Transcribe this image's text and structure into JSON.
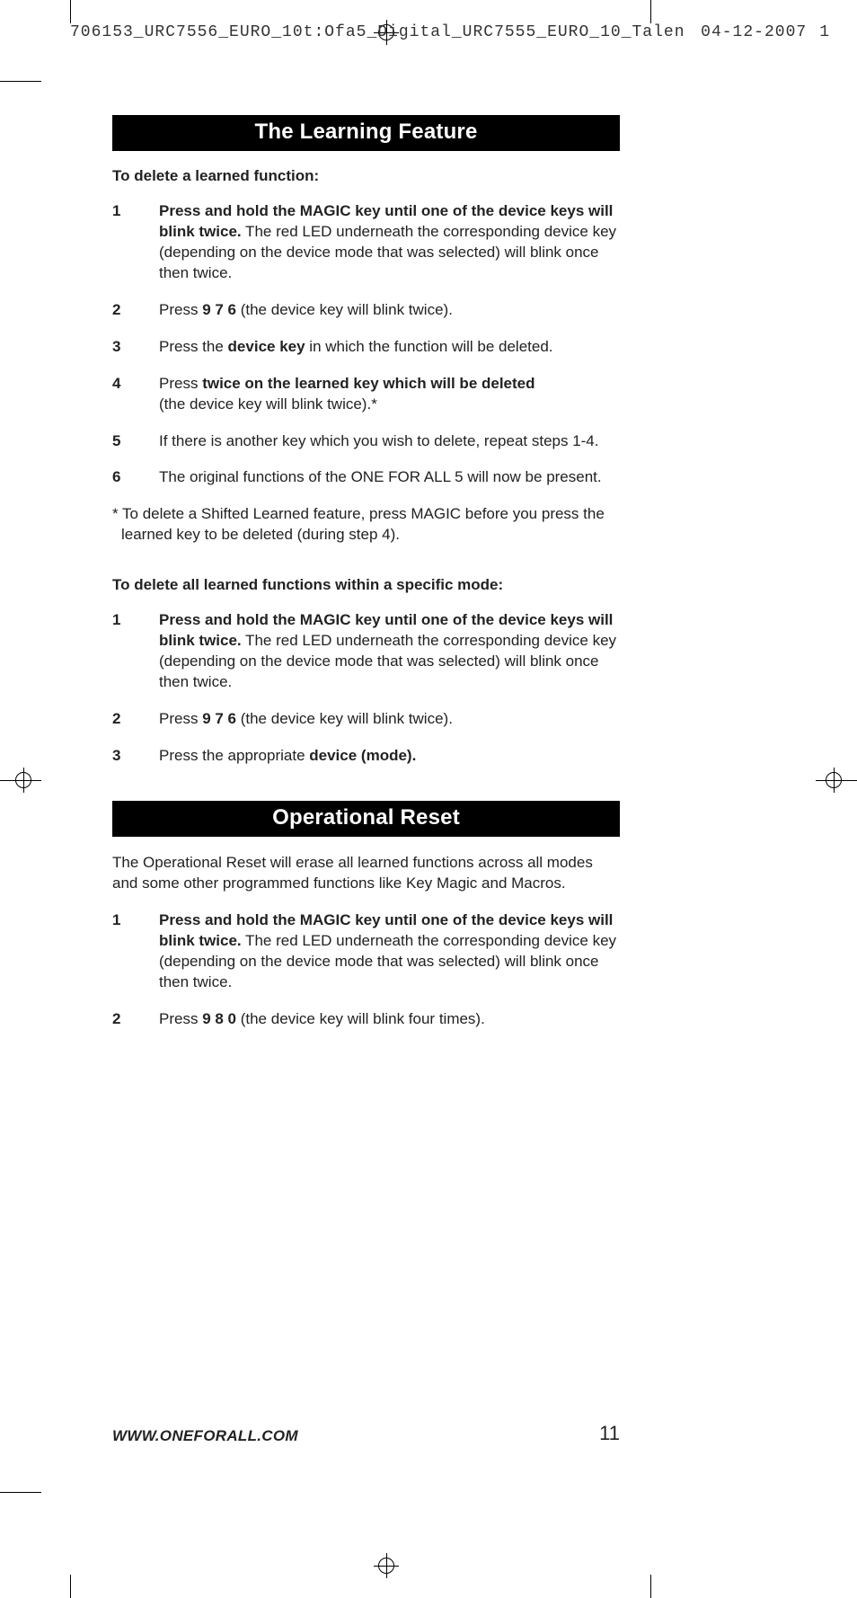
{
  "print_header": {
    "filename": "706153_URC7556_EURO_10t:Ofa5_Digital_URC7555_EURO_10_Talen",
    "date": "04-12-2007",
    "sheet": "1"
  },
  "section1": {
    "title": "The Learning Feature",
    "subA": "To delete a learned function:",
    "stepsA": [
      {
        "num": "1",
        "bold": "Press and hold the MAGIC key until one of the device keys will blink twice.",
        "rest": " The red LED underneath the corresponding  device key (depending on the device mode that was selected)  will blink once then twice."
      },
      {
        "num": "2",
        "pre": "Press ",
        "bold": "9 7 6",
        "rest": " (the device key will blink twice)."
      },
      {
        "num": "3",
        "pre": "Press the ",
        "bold": "device key",
        "rest": " in which the function will be deleted."
      },
      {
        "num": "4",
        "pre": "Press ",
        "bold": "twice on the learned key which will be deleted",
        "rest2": "(the device key will blink twice).*"
      },
      {
        "num": "5",
        "plain": "If there is another key which you wish to delete, repeat steps 1-4."
      },
      {
        "num": "6",
        "plain": "The original functions of the ONE FOR ALL 5 will now be present."
      }
    ],
    "note": "* To delete a Shifted Learned feature, press MAGIC before you press the learned key to be deleted (during step 4).",
    "subB": "To delete all learned functions within a specific mode:",
    "stepsB": [
      {
        "num": "1",
        "bold": "Press and hold the MAGIC key until one of the device keys will blink twice.",
        "rest": " The red LED underneath the corresponding  device key (depending on the device mode that was selected)  will blink once then twice."
      },
      {
        "num": "2",
        "pre": "Press ",
        "bold": "9 7 6",
        "rest": " (the device key will blink twice)."
      },
      {
        "num": "3",
        "pre": "Press the appropriate ",
        "bold": "device (mode)."
      }
    ]
  },
  "section2": {
    "title": "Operational Reset",
    "intro": "The Operational Reset will erase all learned functions across all modes and some other programmed functions like Key Magic and Macros.",
    "steps": [
      {
        "num": "1",
        "bold": "Press and hold the MAGIC key until one of the device keys will blink twice.",
        "rest": " The red LED underneath the corresponding device key (depending on the device mode that was selected) will blink once then twice."
      },
      {
        "num": "2",
        "pre": "Press ",
        "bold": "9 8 0",
        "rest": " (the device key will blink four times)."
      }
    ]
  },
  "footer": {
    "url": "WWW.ONEFORALL.COM",
    "page": "11"
  }
}
